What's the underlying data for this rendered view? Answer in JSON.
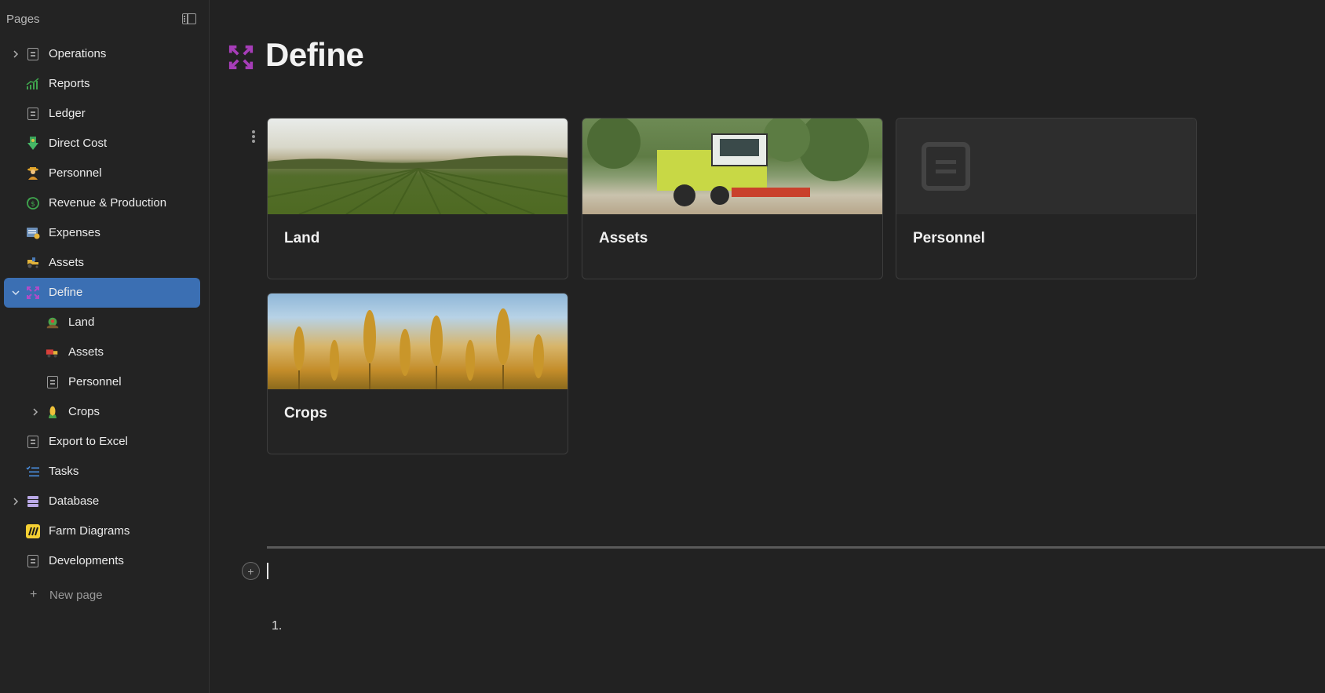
{
  "sidebar": {
    "title": "Pages",
    "items": [
      {
        "label": "Operations",
        "icon": "page-icon",
        "expandable": true
      },
      {
        "label": "Reports",
        "icon": "chart-icon"
      },
      {
        "label": "Ledger",
        "icon": "page-icon"
      },
      {
        "label": "Direct Cost",
        "icon": "money-down-icon"
      },
      {
        "label": "Personnel",
        "icon": "farmer-icon"
      },
      {
        "label": "Revenue & Production",
        "icon": "revenue-icon"
      },
      {
        "label": "Expenses",
        "icon": "expenses-icon"
      },
      {
        "label": "Assets",
        "icon": "tractor-icon"
      },
      {
        "label": "Define",
        "icon": "expand-icon",
        "expanded": true,
        "active": true
      },
      {
        "label": "Land",
        "icon": "land-icon",
        "child": true
      },
      {
        "label": "Assets",
        "icon": "truck-icon",
        "child": true
      },
      {
        "label": "Personnel",
        "icon": "page-icon",
        "child": true
      },
      {
        "label": "Crops",
        "icon": "corn-icon",
        "child": true,
        "expandable": true
      },
      {
        "label": "Export to Excel",
        "icon": "page-icon"
      },
      {
        "label": "Tasks",
        "icon": "tasks-icon"
      },
      {
        "label": "Database",
        "icon": "database-icon",
        "expandable": true
      },
      {
        "label": "Farm Diagrams",
        "icon": "miro-icon"
      },
      {
        "label": "Developments",
        "icon": "page-icon"
      }
    ],
    "new_page_label": "New page"
  },
  "main": {
    "title": "Define",
    "cards": [
      {
        "title": "Land",
        "image": "farm-field"
      },
      {
        "title": "Assets",
        "image": "combine-harvester"
      },
      {
        "title": "Personnel",
        "image": "page-placeholder"
      },
      {
        "title": "Crops",
        "image": "wheat-field"
      }
    ],
    "list_marker": "1."
  },
  "colors": {
    "background": "#222222",
    "active_item": "#3b6fb3",
    "define_icon": "#a63db8"
  }
}
